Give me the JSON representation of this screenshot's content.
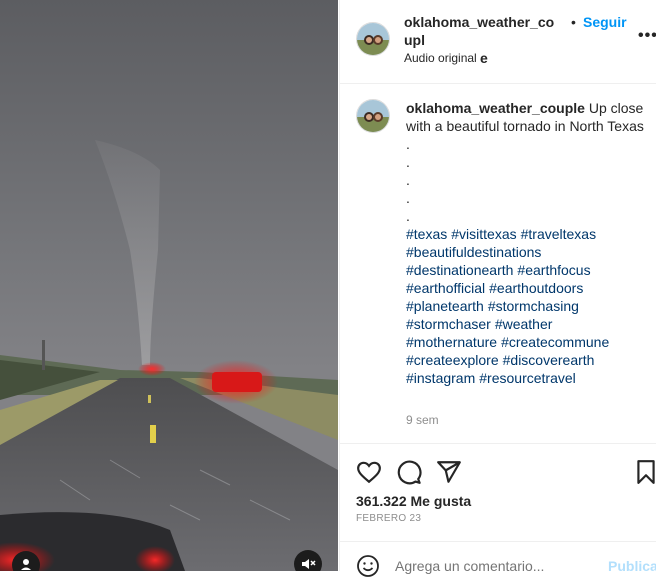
{
  "post": {
    "username": "oklahoma_weather_couple",
    "username_wrapped": "oklahoma_weather_coupl\ne",
    "separator": "•",
    "follow_label": "Seguir",
    "audio_label": "Audio original",
    "more_label": "•••"
  },
  "caption": {
    "username": "oklahoma_weather_couple",
    "text": "Up close with a beautiful tornado in North Texas",
    "dots": [
      ".",
      ".",
      ".",
      ".",
      "."
    ],
    "hashtags": [
      "#texas",
      "#visittexas",
      "#traveltexas",
      "#beautifuldestinations",
      "#destinationearth",
      "#earthfocus",
      "#earthofficial",
      "#earthoutdoors",
      "#planetearth",
      "#stormchasing",
      "#stormchaser",
      "#weather",
      "#mothernature",
      "#createcommune",
      "#createexplore",
      "#discoverearth",
      "#instagram",
      "#resourcetravel"
    ],
    "age": "9 sem"
  },
  "actions": {
    "icons": [
      "heart-icon",
      "comment-icon",
      "share-icon",
      "bookmark-icon"
    ],
    "likes": "361.322 Me gusta",
    "date": "FEBRERO 23"
  },
  "comment": {
    "placeholder": "Agrega un comentario...",
    "publish_label": "Publicar"
  },
  "media": {
    "icons": [
      "mute-icon",
      "user-tag-icon"
    ]
  },
  "colors": {
    "accent": "#0095f6",
    "link": "#00376b",
    "muted": "#8e8e8e",
    "publish_disabled": "#b2dffc"
  }
}
